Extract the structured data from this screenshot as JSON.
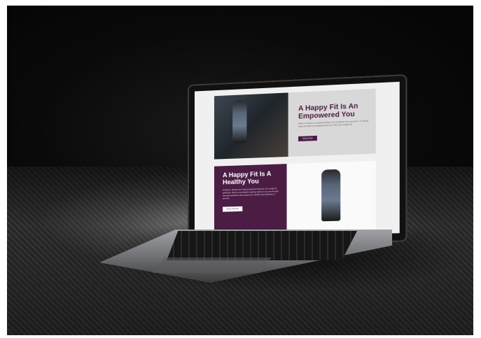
{
  "scene": {
    "description_tag": "laptop-mockup",
    "colors": {
      "brand_purple": "#4b1d45",
      "background": "#0a0a0a",
      "screen_bg": "#f1f0f1"
    }
  },
  "website": {
    "section1": {
      "title": "A Happy Fit Is An Empowered You",
      "body": "When it comes to modest clothes, it's not about 'how you fit in', it's about what you feel in empowering to you. Find your happy fit.",
      "button_label": "Shop Now"
    },
    "section2": {
      "title": "A Happy Fit Is A Healthy You",
      "body": "At Abeer, fitness isn't about anyone's fitness. It's a right to wellness. We're committed to giving back to our community through activities and support for health and wellness of women.",
      "button_label": "Shop Fitness"
    }
  }
}
